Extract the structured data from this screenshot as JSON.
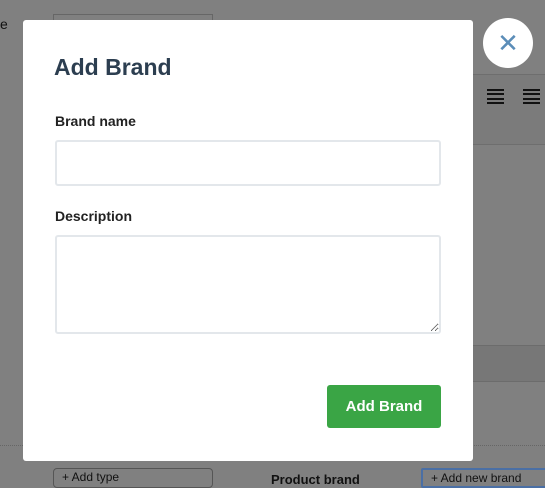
{
  "background": {
    "label_fragment": "e",
    "type_select": "+ Add type",
    "product_brand_label": "Product brand",
    "brand_select": "+ Add new brand"
  },
  "modal": {
    "title": "Add Brand",
    "brand_name_label": "Brand name",
    "brand_name_value": "",
    "description_label": "Description",
    "description_value": "",
    "submit_label": "Add Brand",
    "close_icon": "close-icon"
  },
  "colors": {
    "accent": "#3aa545",
    "title": "#2c3e50",
    "close": "#5b8db8"
  }
}
